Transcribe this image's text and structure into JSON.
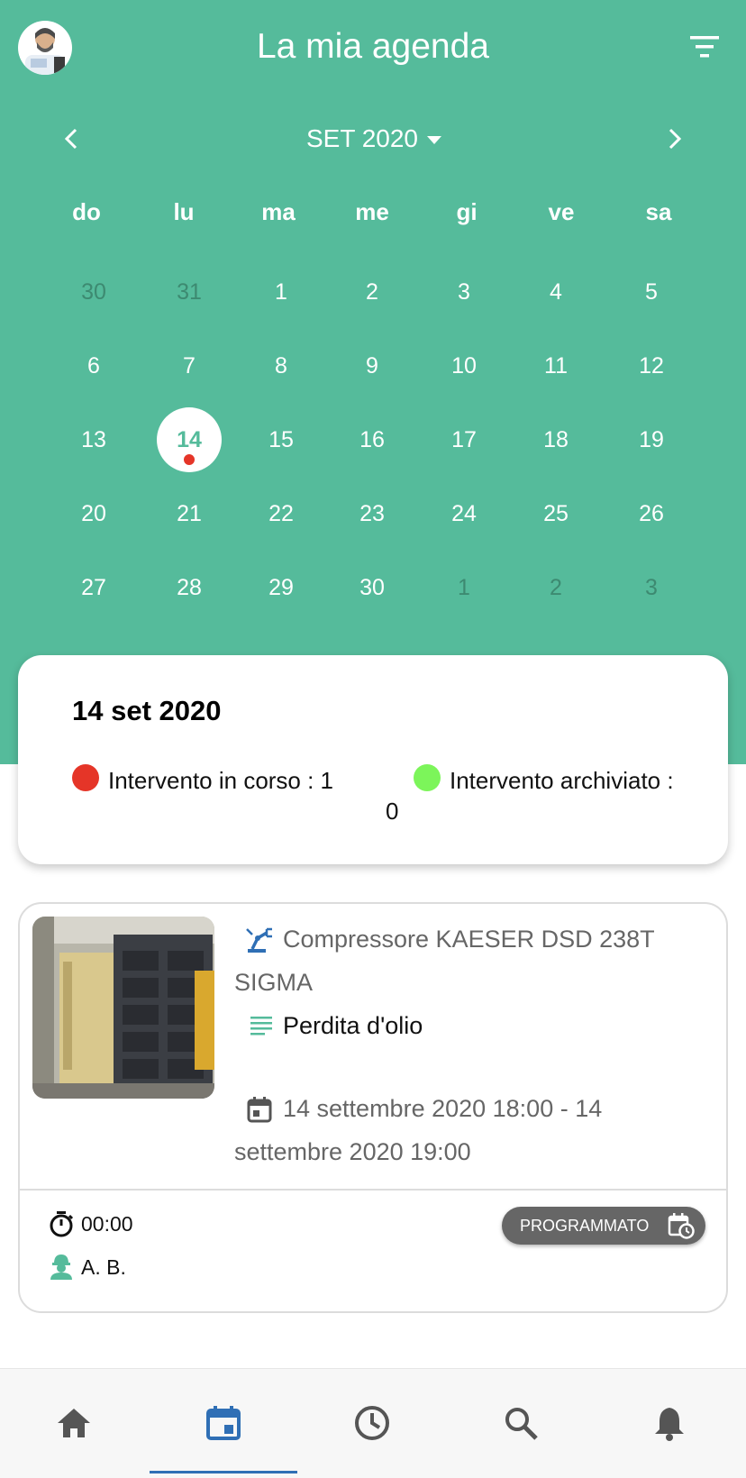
{
  "header": {
    "title": "La mia agenda"
  },
  "calendar": {
    "month_label": "SET 2020",
    "weekdays": [
      "do",
      "lu",
      "ma",
      "me",
      "gi",
      "ve",
      "sa"
    ],
    "weeks": [
      [
        "30",
        "31",
        "1",
        "2",
        "3",
        "4",
        "5"
      ],
      [
        "6",
        "7",
        "8",
        "9",
        "10",
        "11",
        "12"
      ],
      [
        "13",
        "14",
        "15",
        "16",
        "17",
        "18",
        "19"
      ],
      [
        "20",
        "21",
        "22",
        "23",
        "24",
        "25",
        "26"
      ],
      [
        "27",
        "28",
        "29",
        "30",
        "1",
        "2",
        "3"
      ]
    ],
    "selected_day": "14"
  },
  "summary": {
    "date": "14 set 2020",
    "in_progress_label": "Intervento in corso : 1",
    "archived_label": "Intervento archiviato :",
    "archived_count": "0",
    "colors": {
      "in_progress": "#e53528",
      "archived": "#7cf55a"
    }
  },
  "intervention": {
    "asset_line1": "Compressore KAESER DSD 238T",
    "asset_line2": "SIGMA",
    "description": "Perdita d'olio",
    "schedule_line1": "14 settembre 2020 18:00 - 14",
    "schedule_line2": "settembre 2020 19:00",
    "duration": "00:00",
    "technician": "A. B.",
    "status": "PROGRAMMATO"
  },
  "bottom_nav": {
    "items": [
      "home-icon",
      "calendar-icon",
      "clock-icon",
      "search-icon",
      "bell-icon"
    ],
    "active": "calendar-icon"
  },
  "colors": {
    "primary": "#55bb9b",
    "accent_blue": "#2f6fb5"
  }
}
